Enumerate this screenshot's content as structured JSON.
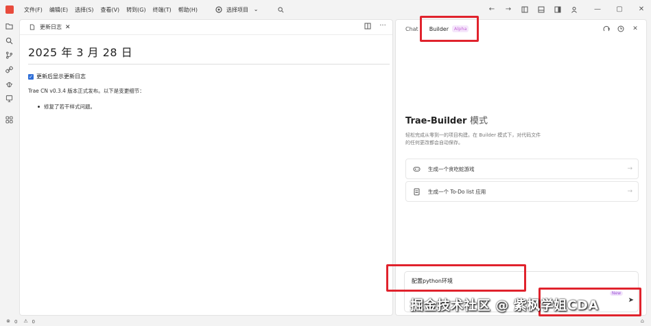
{
  "menu": [
    "文件(F)",
    "编辑(E)",
    "选择(S)",
    "查看(V)",
    "转到(G)",
    "终端(T)",
    "帮助(H)"
  ],
  "project_selector": "选择项目",
  "editor": {
    "tab_label": "更新日志",
    "doc_title": "2025 年 3 月 28 日",
    "checkbox_label": "更新后显示更新日志",
    "release_text": "Trae CN v0.3.4 版本正式发布。以下是变更细节：",
    "bullets": [
      "修复了若干样式问题。"
    ]
  },
  "panel": {
    "tab_chat": "Chat",
    "tab_builder": "Builder",
    "alpha_badge": "Alpha",
    "intro_title": "Trae-Builder",
    "intro_mode": "模式",
    "intro_desc": "轻松完成从零到一的项目构建。在 Builder 模式下，对代码文件的任何更改都会自动保存。",
    "suggestions": [
      {
        "icon": "gamepad-icon",
        "label": "生成一个贪吃蛇游戏"
      },
      {
        "icon": "note-icon",
        "label": "生成一个 To-Do list 应用"
      }
    ],
    "input_value": "配置python环境",
    "new_badge": "New"
  },
  "status": {
    "errors": "0",
    "warnings": "0"
  },
  "watermark": "掘金技术社区 @ 紫枫学姐CDA",
  "colors": {
    "highlight": "#e0222c",
    "accent": "#2f6fd8",
    "logo": "#e84b3c"
  }
}
